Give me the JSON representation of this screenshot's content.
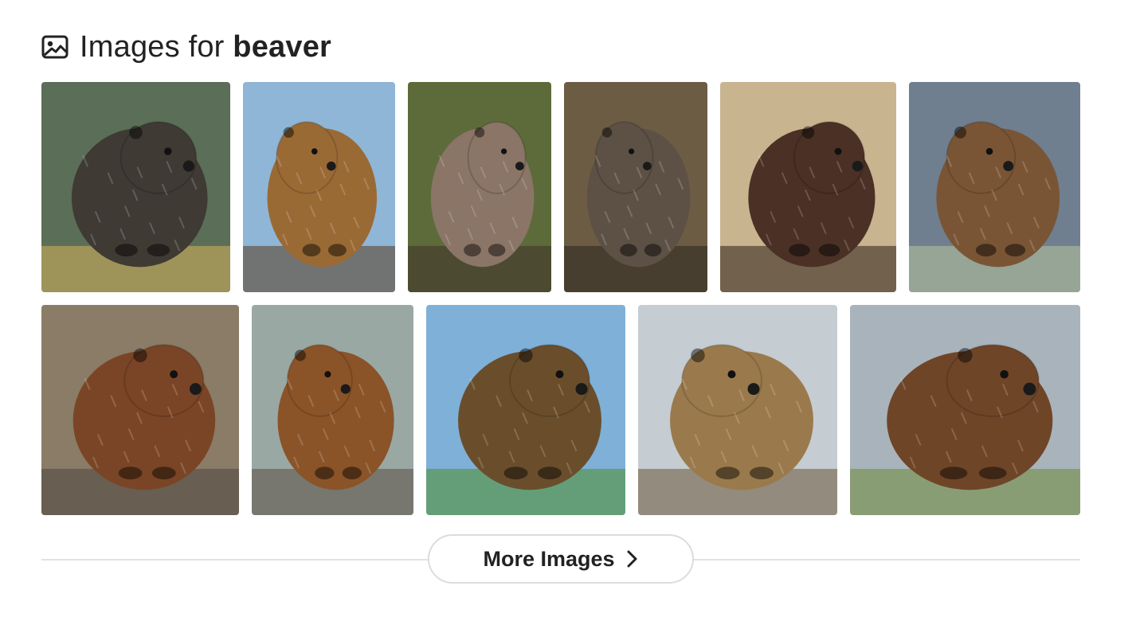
{
  "header": {
    "icon": "image-icon",
    "title_prefix": "Images for ",
    "query": "beaver"
  },
  "images": [
    {
      "subject": "beaver",
      "bg": "#5b6e57",
      "fur": "#3f3a34",
      "accent": "#d6b35a"
    },
    {
      "subject": "beaver",
      "bg": "#8fb6d6",
      "fur": "#9a6a35",
      "accent": "#5a3a20"
    },
    {
      "subject": "beaver",
      "bg": "#5d6b3a",
      "fur": "#8a7566",
      "accent": "#3e3028"
    },
    {
      "subject": "beaver",
      "bg": "#6c5c44",
      "fur": "#5d5146",
      "accent": "#2a261f"
    },
    {
      "subject": "beaver",
      "bg": "#c8b48f",
      "fur": "#4a3025",
      "accent": "#2c1d16"
    },
    {
      "subject": "beaver",
      "bg": "#6f7f8f",
      "fur": "#7a5535",
      "accent": "#b7c59a"
    },
    {
      "subject": "beaver",
      "bg": "#8a7c66",
      "fur": "#7a4526",
      "accent": "#4c4640"
    },
    {
      "subject": "beaver",
      "bg": "#9aa8a4",
      "fur": "#8a5428",
      "accent": "#5b4f45"
    },
    {
      "subject": "beaver",
      "bg": "#7fb0d8",
      "fur": "#6a4e2c",
      "accent": "#4f8f2a"
    },
    {
      "subject": "beaver",
      "bg": "#c5ccd2",
      "fur": "#9a7a4c",
      "accent": "#6a5536"
    },
    {
      "subject": "beaver",
      "bg": "#a9b3bb",
      "fur": "#6f4528",
      "accent": "#6f8a3a"
    }
  ],
  "more_button": {
    "label": "More Images",
    "icon": "chevron-right-icon"
  }
}
